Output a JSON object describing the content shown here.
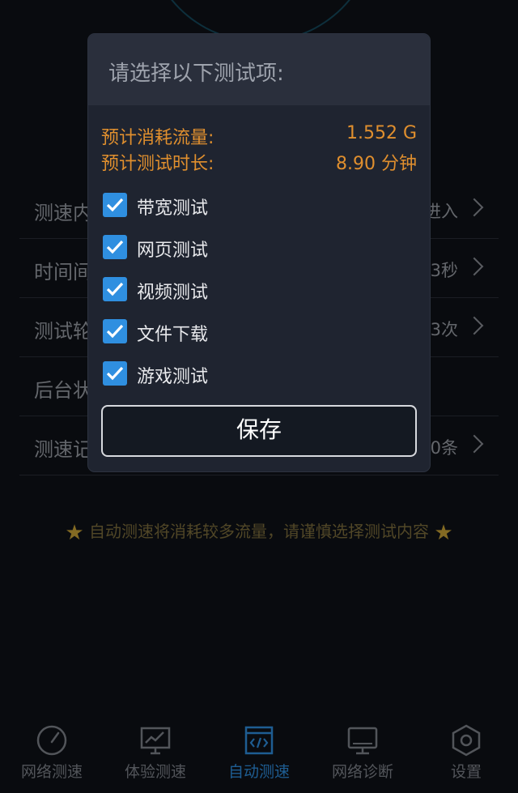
{
  "settings": {
    "rows": [
      {
        "label": "测速内",
        "value": "进入"
      },
      {
        "label": "时间间",
        "value": "3秒"
      },
      {
        "label": "测试轮",
        "value": "3次"
      },
      {
        "label": "后台状",
        "value": ""
      },
      {
        "label": "测速记",
        "value": "0条"
      }
    ]
  },
  "warning": {
    "text": "自动测速将消耗较多流量，请谨慎选择测试内容"
  },
  "bottom_nav": {
    "items": [
      {
        "label": "网络测速",
        "icon": "speedometer-icon"
      },
      {
        "label": "体验测速",
        "icon": "monitor-chart-icon"
      },
      {
        "label": "自动测速",
        "icon": "code-window-icon",
        "active": true
      },
      {
        "label": "网络诊断",
        "icon": "desktop-icon"
      },
      {
        "label": "设置",
        "icon": "hexagon-gear-icon"
      }
    ],
    "active_color": "#2f8fe0"
  },
  "dialog": {
    "title": "请选择以下测试项:",
    "traffic_label": "预计消耗流量:",
    "traffic_value": "1.552 G",
    "duration_label": "预计测试时长:",
    "duration_value": "8.90 分钟",
    "options": [
      {
        "label": "带宽测试",
        "checked": true
      },
      {
        "label": "网页测试",
        "checked": true
      },
      {
        "label": "视频测试",
        "checked": true
      },
      {
        "label": "文件下载",
        "checked": true
      },
      {
        "label": "游戏测试",
        "checked": true
      }
    ],
    "save_label": "保存",
    "accent": "#e08f2e",
    "checkbox_color": "#2f8fe0"
  }
}
